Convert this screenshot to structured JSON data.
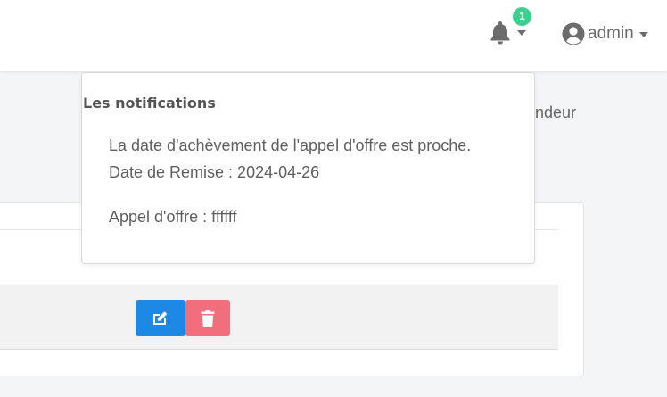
{
  "header": {
    "notification_count": "1",
    "user_name": "admin"
  },
  "background": {
    "partial_text": "andeur"
  },
  "notifications": {
    "title": "Les notifications",
    "message": "La date d'achèvement de l'appel d'offre est proche.",
    "due_date": "Date de Remise : 2024-04-26",
    "tender": "Appel d'offre : ffffff"
  },
  "actions": {
    "edit_icon": "edit-icon",
    "delete_icon": "trash-icon"
  },
  "colors": {
    "badge": "#3ecf8e",
    "edit_button": "#1e88e5",
    "delete_button": "#f16f7c"
  }
}
